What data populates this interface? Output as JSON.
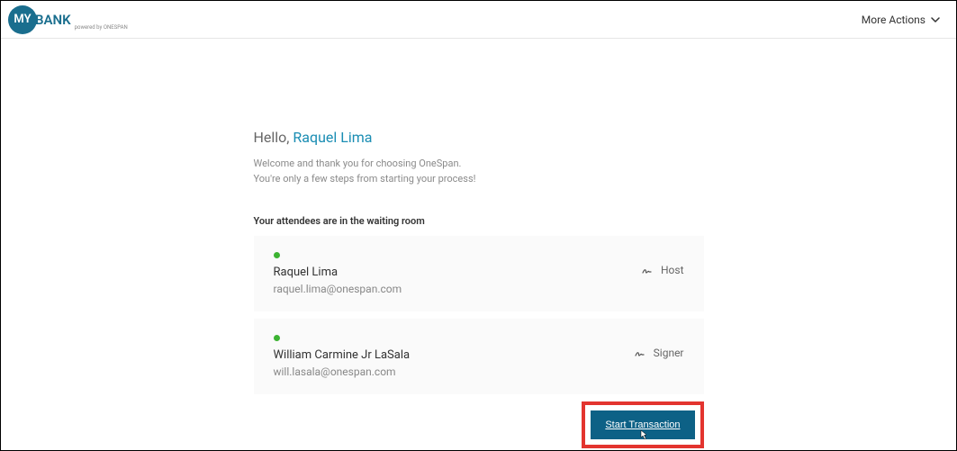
{
  "header": {
    "logo_circle_text": "MY",
    "logo_text": "BANK",
    "logo_sub": "powered by ONESPAN",
    "more_actions_label": "More Actions"
  },
  "greeting": {
    "label": "Hello, ",
    "name": "Raquel Lima"
  },
  "welcome": {
    "line1": "Welcome and thank you for choosing OneSpan.",
    "line2": "You're only a few steps from starting your process!"
  },
  "section_title": "Your attendees are in the waiting room",
  "attendees": [
    {
      "name": "Raquel Lima",
      "email": "raquel.lima@onespan.com",
      "role": "Host"
    },
    {
      "name": "William Carmine Jr LaSala",
      "email": "will.lasala@onespan.com",
      "role": "Signer"
    }
  ],
  "start_button_label": "Start Transaction"
}
